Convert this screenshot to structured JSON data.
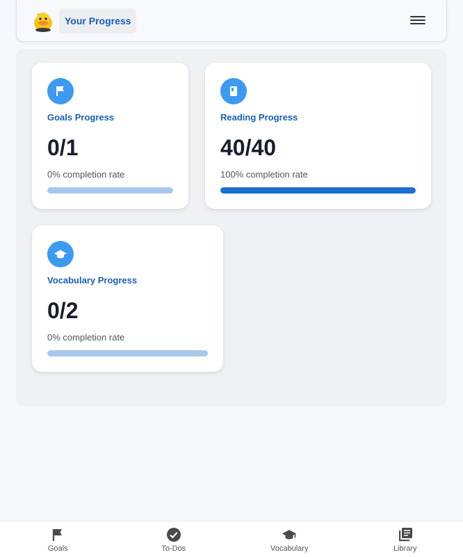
{
  "header": {
    "title": "Your Progress",
    "logo": "duck-logo",
    "menu_icon": "hamburger-menu-icon"
  },
  "cards": [
    {
      "label": "Goals Progress",
      "value": "0/1",
      "rate": "0% completion rate",
      "progress": 0,
      "icon": "flag-icon"
    },
    {
      "label": "Reading Progress",
      "value": "40/40",
      "rate": "100% completion rate",
      "progress": 1,
      "icon": "book-icon"
    },
    {
      "label": "Vocabulary Progress",
      "value": "0/2",
      "rate": "0% completion rate",
      "progress": 0,
      "icon": "graduation-cap-icon"
    }
  ],
  "nav": [
    {
      "label": "Goals",
      "icon": "flag-icon"
    },
    {
      "label": "To-Dos",
      "icon": "check-circle-icon"
    },
    {
      "label": "Vocabulary",
      "icon": "graduation-cap-icon"
    },
    {
      "label": "Library",
      "icon": "library-icon"
    }
  ],
  "colors": {
    "accent": "#1a5fb4",
    "icon_bg": "#3c9af0",
    "bar_fill": "#1a6fd0",
    "bar_track": "#a9c9ec"
  }
}
